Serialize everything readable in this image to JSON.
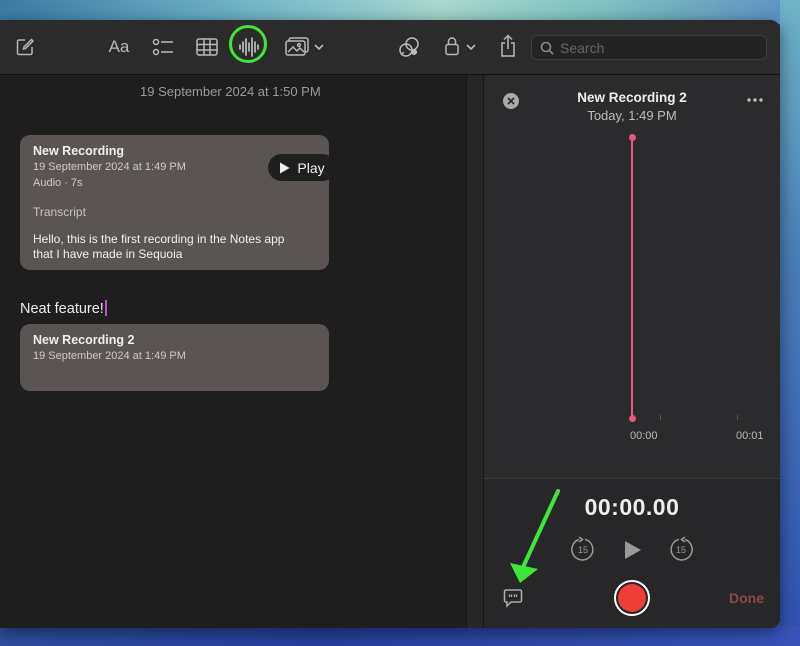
{
  "toolbar": {
    "format_label": "Aa",
    "search_placeholder": "Search",
    "icons": [
      "compose-icon",
      "format-text-icon",
      "checklist-icon",
      "table-icon",
      "audio-waveform-icon",
      "media-icon",
      "chevron-down-icon",
      "collaborate-icon",
      "lock-icon",
      "chevron-down-icon",
      "share-icon",
      "search-icon"
    ],
    "highlight_color": "#3ee63a"
  },
  "note": {
    "date": "19 September 2024 at 1:50 PM",
    "recordings": [
      {
        "title": "New Recording",
        "date": "19 September 2024 at 1:49 PM",
        "meta": "Audio · 7s",
        "play_label": "Play",
        "transcript_label": "Transcript",
        "transcript_line1": "Hello, this is the first recording in the Notes app",
        "transcript_line2": "that I have made in Sequoia"
      },
      {
        "title": "New Recording 2",
        "date": "19 September 2024 at 1:49 PM"
      }
    ],
    "body_text": "Neat feature!"
  },
  "recorder": {
    "title": "New Recording 2",
    "subtitle": "Today, 1:49 PM",
    "timeline_start": "00:00",
    "timeline_end": "00:01",
    "elapsed": "00:00.00",
    "skip_seconds": "15",
    "done_label": "Done",
    "accent_color": "#e25b7c",
    "record_color": "#ef3e35"
  },
  "annotation": {
    "arrow_color": "#3ee63a"
  }
}
